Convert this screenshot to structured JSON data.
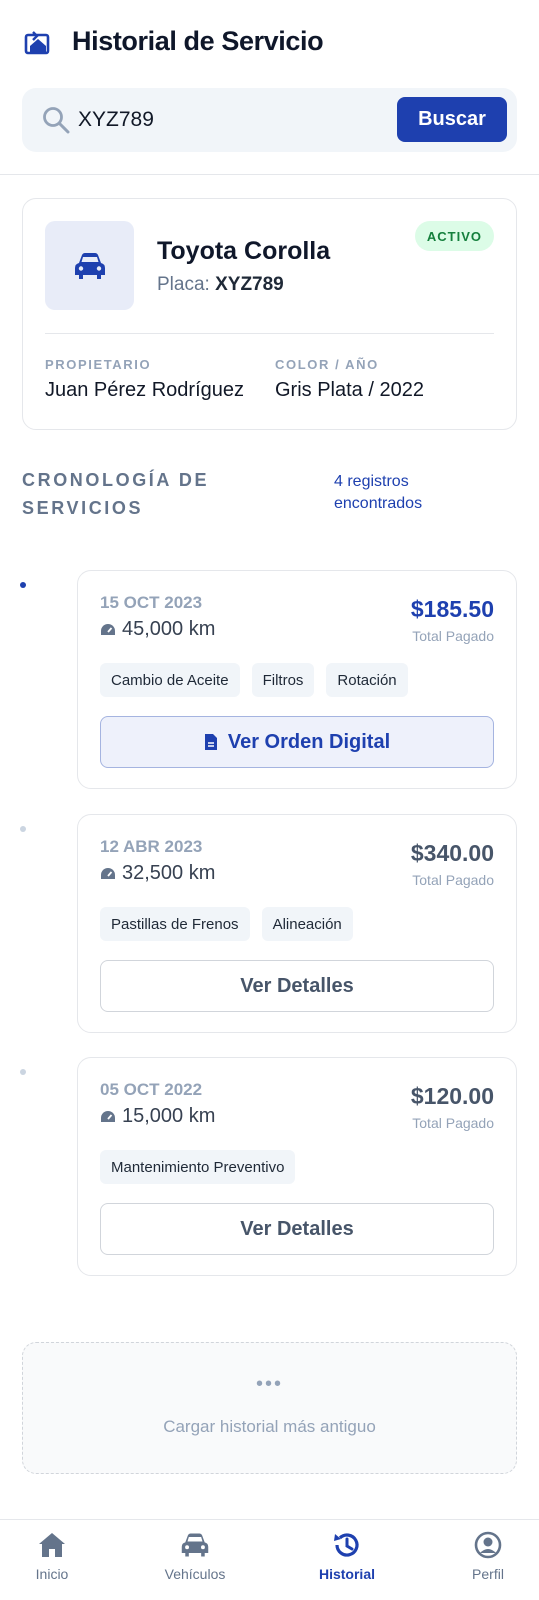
{
  "header": {
    "title": "Historial de Servicio"
  },
  "search": {
    "value": "XYZ789",
    "button_label": "Buscar"
  },
  "vehicle": {
    "name": "Toyota Corolla",
    "plate_label": "Placa:",
    "plate": "XYZ789",
    "status": "ACTIVO",
    "owner_label": "PROPIETARIO",
    "owner": "Juan Pérez Rodríguez",
    "color_year_label": "COLOR / AÑO",
    "color_year": "Gris Plata / 2022"
  },
  "timeline": {
    "title": "CRONOLOGÍA DE SERVICIOS",
    "count": "4 registros encontrados"
  },
  "services": [
    {
      "date": "15 OCT 2023",
      "km": "45,000 km",
      "price": "$185.50",
      "paid_label": "Total Pagado",
      "tags": [
        "Cambio de Aceite",
        "Filtros",
        "Rotación"
      ],
      "action": "Ver Orden Digital"
    },
    {
      "date": "12 ABR 2023",
      "km": "32,500 km",
      "price": "$340.00",
      "paid_label": "Total Pagado",
      "tags": [
        "Pastillas de Frenos",
        "Alineación"
      ],
      "action": "Ver Detalles"
    },
    {
      "date": "05 OCT 2022",
      "km": "15,000 km",
      "price": "$120.00",
      "paid_label": "Total Pagado",
      "tags": [
        "Mantenimiento Preventivo"
      ],
      "action": "Ver Detalles"
    }
  ],
  "load_more": {
    "dots": "•••",
    "label": "Cargar historial más antiguo"
  },
  "nav": [
    {
      "label": "Inicio",
      "icon": "home-icon"
    },
    {
      "label": "Vehículos",
      "icon": "car-icon"
    },
    {
      "label": "Historial",
      "icon": "history-icon",
      "active": true
    },
    {
      "label": "Perfil",
      "icon": "profile-icon"
    }
  ],
  "colors": {
    "accent": "#1e40af",
    "active_badge_bg": "#dcfce7",
    "active_badge_text": "#15803d"
  }
}
